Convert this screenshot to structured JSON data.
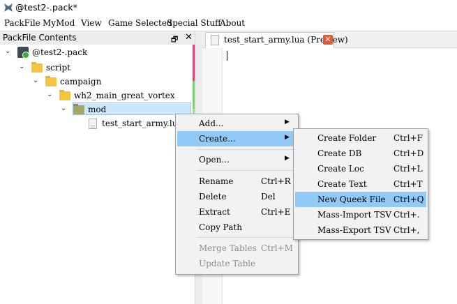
{
  "window": {
    "title": "@test2-.pack*"
  },
  "menubar": [
    "PackFile",
    "MyMod",
    "View",
    "Game Selected",
    "Special Stuff",
    "About"
  ],
  "dock": {
    "title": "PackFile Contents",
    "float_glyph": "🗗",
    "close_glyph": "✕"
  },
  "tree": {
    "items": [
      {
        "label": "@test2-.pack",
        "icon": "pack-icon"
      },
      {
        "label": "script",
        "icon": "folder-icon"
      },
      {
        "label": "campaign",
        "icon": "folder-icon"
      },
      {
        "label": "wh2_main_great_vortex",
        "icon": "folder-icon"
      },
      {
        "label": "mod",
        "icon": "folder-icon",
        "selected": true
      },
      {
        "label": "test_start_army.lua",
        "icon": "file-icon"
      }
    ]
  },
  "editor": {
    "tab_label": "test_start_army.lua (Preview)"
  },
  "context_menu": {
    "items": [
      {
        "label": "Add...",
        "has_submenu": true
      },
      {
        "label": "Create...",
        "has_submenu": true,
        "highlighted": true
      },
      {
        "label": "Open...",
        "has_submenu": true
      },
      {
        "label": "Rename",
        "shortcut": "Ctrl+R"
      },
      {
        "label": "Delete",
        "shortcut": "Del"
      },
      {
        "label": "Extract",
        "shortcut": "Ctrl+E"
      },
      {
        "label": "Copy Path"
      },
      {
        "label": "Merge Tables",
        "shortcut": "Ctrl+M",
        "disabled": true
      },
      {
        "label": "Update Table",
        "disabled": true
      }
    ]
  },
  "submenu": {
    "items": [
      {
        "label": "Create Folder",
        "shortcut": "Ctrl+F"
      },
      {
        "label": "Create DB",
        "shortcut": "Ctrl+D"
      },
      {
        "label": "Create Loc",
        "shortcut": "Ctrl+L"
      },
      {
        "label": "Create Text",
        "shortcut": "Ctrl+T"
      },
      {
        "label": "New Queek File",
        "shortcut": "Ctrl+Q",
        "highlighted": true
      },
      {
        "label": "Mass-Import TSV",
        "shortcut": "Ctrl+."
      },
      {
        "label": "Mass-Export TSV",
        "shortcut": "Ctrl+,"
      }
    ]
  },
  "colors": {
    "highlight": "#91c9f7",
    "tree_selection": "#cce8ff",
    "folder": "#f3c63d",
    "close_button": "#e2593e",
    "strip_pink": "#d6467c",
    "strip_green": "#7fcf7f"
  }
}
